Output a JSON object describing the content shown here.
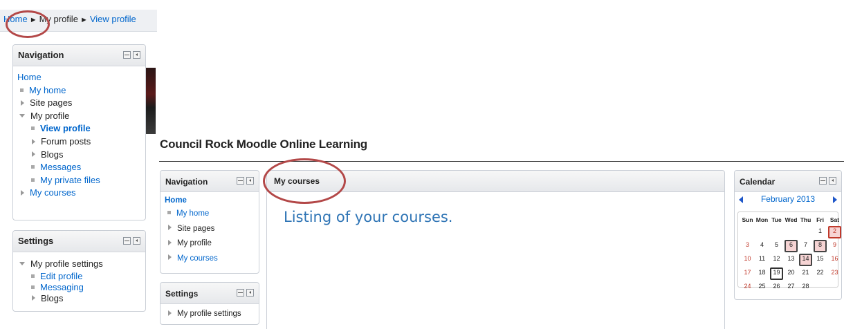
{
  "breadcrumb": {
    "items": [
      "Home",
      "My profile",
      "View profile"
    ],
    "separator": "►"
  },
  "left_navigation": {
    "title": "Navigation",
    "items": [
      {
        "label": "Home",
        "type": "link"
      },
      {
        "label": "My home",
        "type": "leaf-link"
      },
      {
        "label": "Site pages",
        "type": "collapsed"
      },
      {
        "label": "My profile",
        "type": "expanded"
      },
      {
        "label": "View profile",
        "type": "leaf-link-bold"
      },
      {
        "label": "Forum posts",
        "type": "collapsed"
      },
      {
        "label": "Blogs",
        "type": "collapsed"
      },
      {
        "label": "Messages",
        "type": "leaf-link"
      },
      {
        "label": "My private files",
        "type": "leaf-link"
      },
      {
        "label": "My courses",
        "type": "collapsed"
      }
    ]
  },
  "left_settings": {
    "title": "Settings",
    "items": [
      {
        "label": "My profile settings",
        "type": "expanded"
      },
      {
        "label": "Edit profile",
        "type": "leaf-link"
      },
      {
        "label": "Messaging",
        "type": "leaf-link"
      },
      {
        "label": "Blogs",
        "type": "collapsed"
      }
    ]
  },
  "site": {
    "title": "Council Rock Moodle Online Learning"
  },
  "inner_navigation": {
    "title": "Navigation",
    "items": [
      {
        "label": "Home",
        "type": "link-bold"
      },
      {
        "label": "My home",
        "type": "leaf-link"
      },
      {
        "label": "Site pages",
        "type": "collapsed"
      },
      {
        "label": "My profile",
        "type": "collapsed"
      },
      {
        "label": "My courses",
        "type": "collapsed-link"
      }
    ]
  },
  "inner_settings": {
    "title": "Settings",
    "items": [
      {
        "label": "My profile settings",
        "type": "collapsed"
      }
    ]
  },
  "main": {
    "header": "My courses",
    "annotation": "Listing of your courses."
  },
  "calendar": {
    "title": "Calendar",
    "month": "February 2013",
    "weekdays": [
      "Sun",
      "Mon",
      "Tue",
      "Wed",
      "Thu",
      "Fri",
      "Sat"
    ],
    "weeks": [
      [
        "",
        "",
        "",
        "",
        "",
        "1",
        "2"
      ],
      [
        "3",
        "4",
        "5",
        "6",
        "7",
        "8",
        "9"
      ],
      [
        "10",
        "11",
        "12",
        "13",
        "14",
        "15",
        "16"
      ],
      [
        "17",
        "18",
        "19",
        "20",
        "21",
        "22",
        "23"
      ],
      [
        "24",
        "25",
        "26",
        "27",
        "28",
        "",
        ""
      ]
    ],
    "event_days": [
      "2",
      "6",
      "8",
      "14"
    ],
    "today": "19",
    "colors": {
      "weekend": "#c0392b",
      "event_bg": "#f6d4d4",
      "event_border": "#444444"
    }
  },
  "colors": {
    "link": "#0066cc",
    "annotation_circle": "#b34848",
    "annotation_text": "#2e74b5"
  }
}
